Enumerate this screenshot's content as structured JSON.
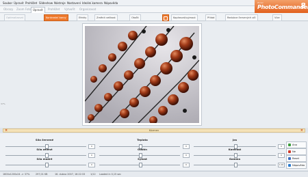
{
  "menu": [
    "Soubor",
    "Úpravit",
    "Prohlížet",
    "Slideshow",
    "Nástroje",
    "Nastavení",
    "Ideální.kamera",
    "Nápověda"
  ],
  "brand": {
    "tagline": "Zoner",
    "name": "PhotoCommander",
    "version": "8"
  },
  "tabs": [
    {
      "label": "Obrazy",
      "active": false
    },
    {
      "label": "Zoom Foto",
      "active": false
    },
    {
      "label": "Úpravit",
      "active": true
    },
    {
      "label": "Prohlížet",
      "active": false
    },
    {
      "label": "Vytvořit",
      "active": false
    },
    {
      "label": "Organizovat",
      "active": false
    }
  ],
  "toolbar": [
    {
      "label": "Optimalizovat",
      "state": "disabled"
    },
    {
      "label": "Kontrastní barvy",
      "state": "on"
    },
    {
      "label": "Efekty",
      "state": "normal"
    },
    {
      "label": "Změnit velikost",
      "state": "normal"
    },
    {
      "label": "Otočit",
      "state": "normal"
    },
    {
      "label": "",
      "state": "on",
      "icon": "palette-icon"
    },
    {
      "label": "Kopírovat/vyjmout",
      "state": "normal"
    },
    {
      "label": "Přidat",
      "state": "normal"
    },
    {
      "label": "Redukce červených očí",
      "state": "normal"
    },
    {
      "label": "Více",
      "state": "normal"
    }
  ],
  "canvas": {
    "zoom_label": "37%"
  },
  "panel": {
    "title": "Kúzmen",
    "close_icon": "close-icon"
  },
  "sliders": [
    {
      "label": "Síla červené",
      "value": "0",
      "level": 0.5
    },
    {
      "label": "Teplota",
      "value": "0",
      "level": 0.5
    },
    {
      "label": "Jas",
      "value": "0",
      "level": 0.5
    },
    {
      "label": "Síla zelené",
      "value": "0",
      "level": 0.5
    },
    {
      "label": "Odstín",
      "value": "0",
      "level": 0.5
    },
    {
      "label": "Kontrast",
      "value": "0",
      "level": 0.5
    },
    {
      "label": "Síla modré",
      "value": "0",
      "level": 0.5
    },
    {
      "label": "Sytost",
      "value": "0",
      "level": 0.5
    },
    {
      "label": "Gamma",
      "value": "1,00",
      "level": 0.5
    }
  ],
  "actions": [
    {
      "label": "Ano",
      "icon": "check-icon",
      "color": "#3a9c3a"
    },
    {
      "label": "Ne",
      "icon": "close-icon",
      "color": "#d03a2a"
    },
    {
      "label": "Reset",
      "icon": "reset-icon",
      "color": "#3a6cc0"
    },
    {
      "label": "Nápověda",
      "icon": "help-icon",
      "color": "#2a7ad0"
    }
  ],
  "status": {
    "dims": "1600x1200x24 -> 37%",
    "size": "297,01 KB",
    "date": "16. dubna 2007, 16:22:33",
    "pos": "1/12",
    "loaded": "Loaded in 0,15 sec"
  },
  "colors": {
    "accent": "#ef7a2e",
    "bead": "#8a2a12"
  }
}
